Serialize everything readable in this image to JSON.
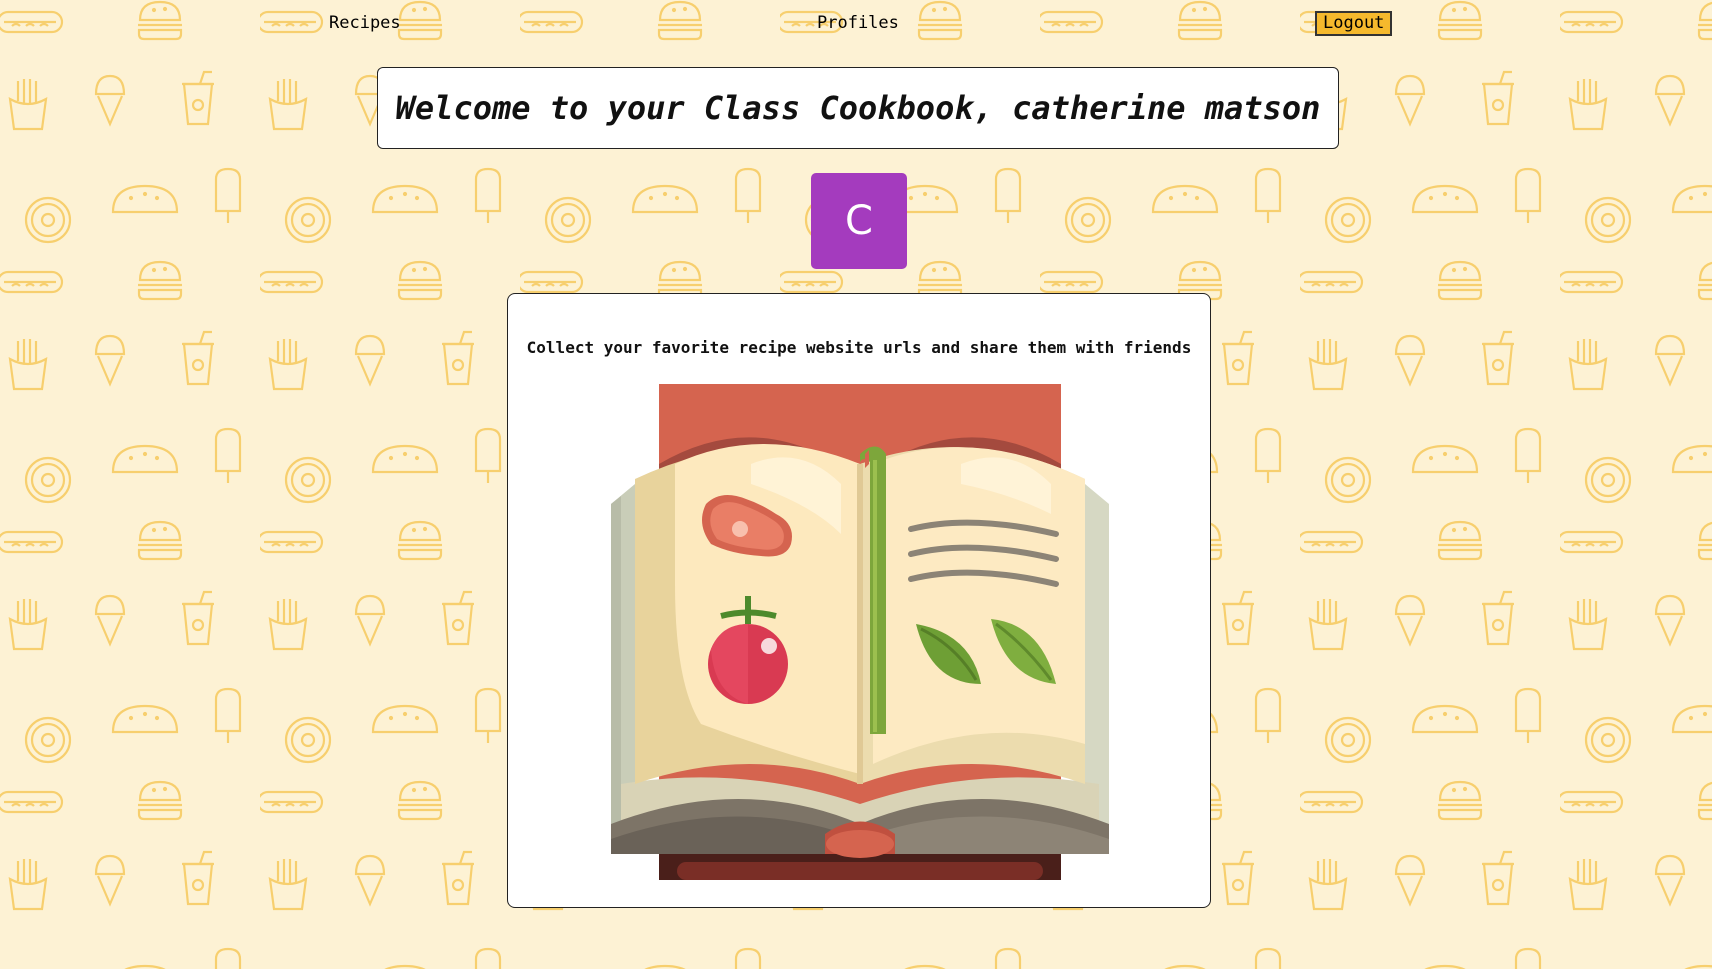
{
  "nav": {
    "recipes_label": "Recipes",
    "profiles_label": "Profiles",
    "logout_label": "Logout"
  },
  "header": {
    "welcome_title": "Welcome to your Class Cookbook, catherine matson"
  },
  "avatar": {
    "initial": "C",
    "color": "#a43bbe"
  },
  "card": {
    "tagline": "Collect your favorite recipe website urls and share them with friends",
    "illustration_icon": "open-cookbook-icon"
  },
  "colors": {
    "background": "#fdf2d4",
    "pattern": "#f7cf6e",
    "logout_button": "#f5b92d",
    "avatar": "#a43bbe"
  }
}
